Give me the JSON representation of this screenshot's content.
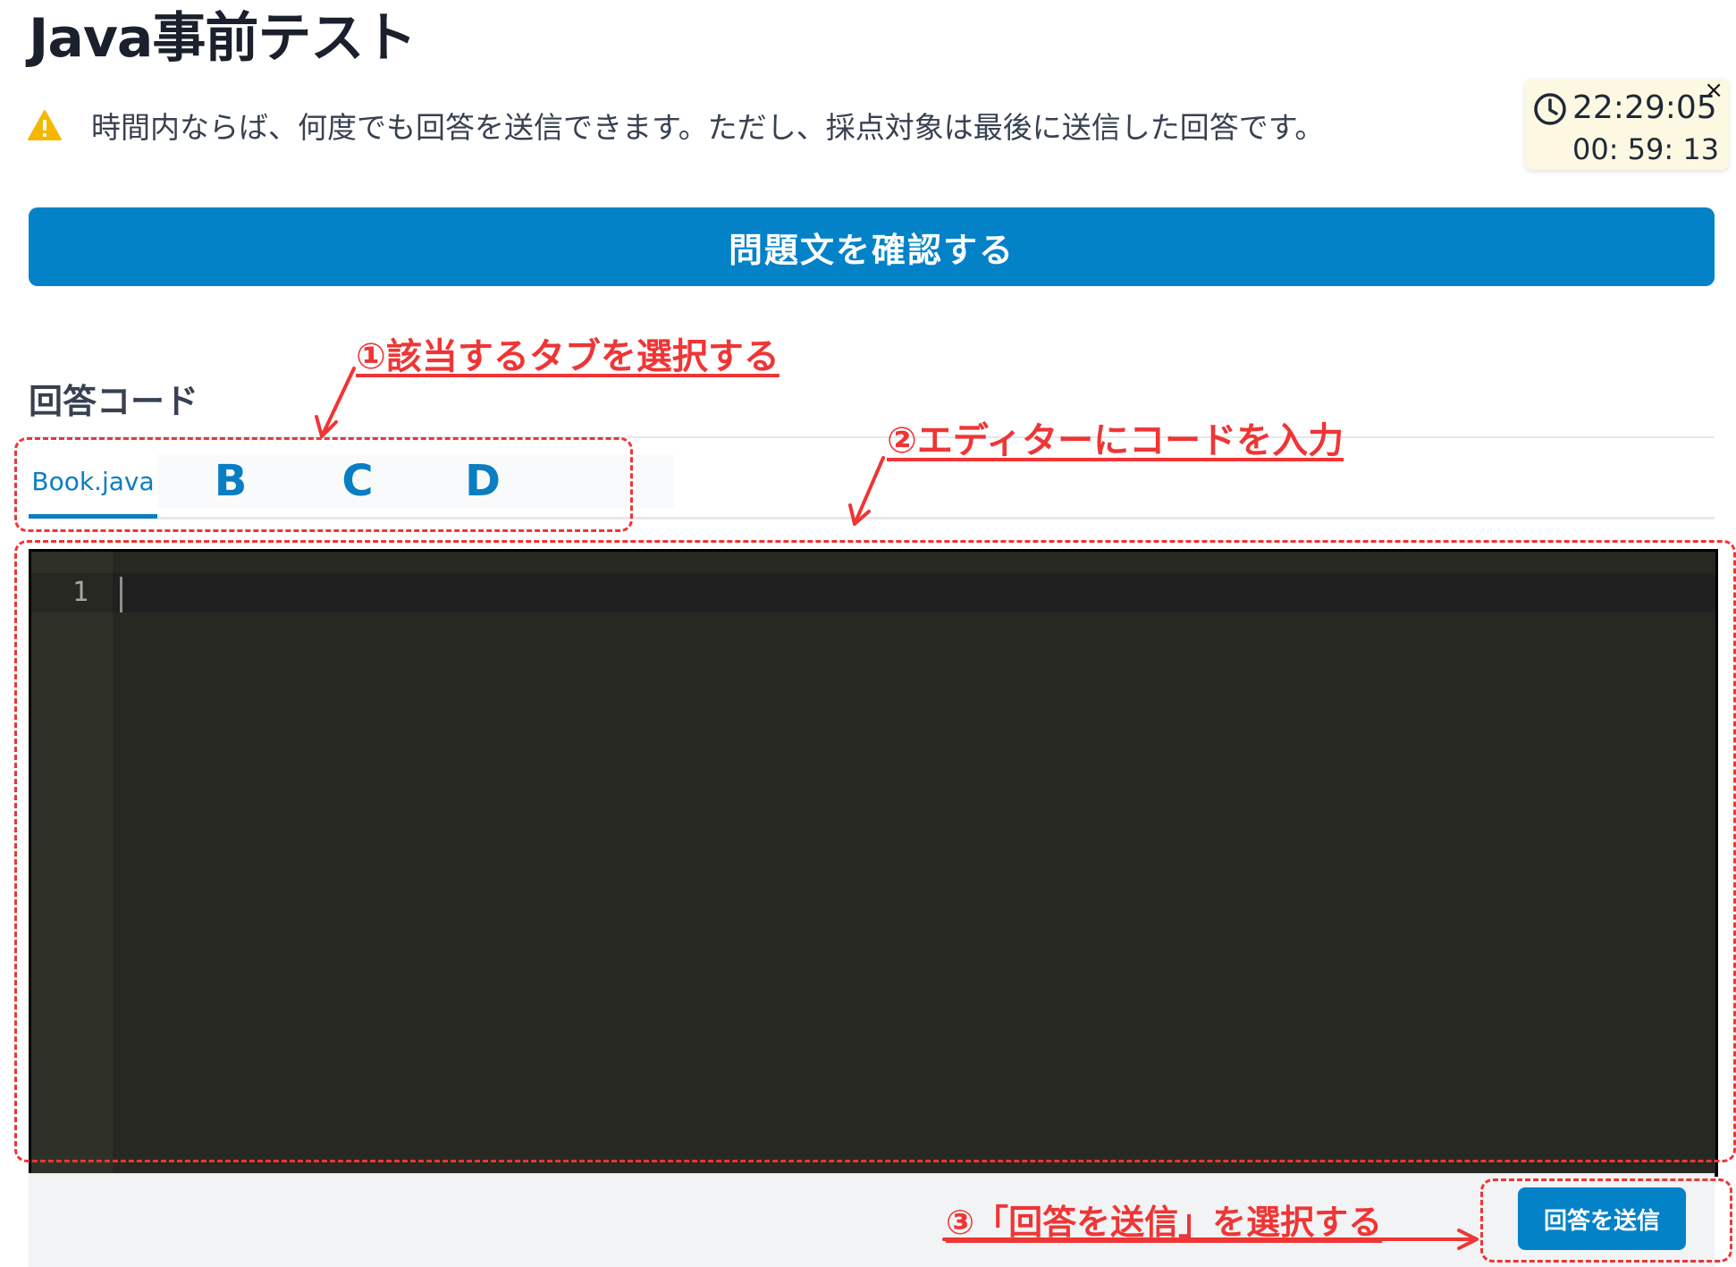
{
  "page": {
    "title": "Java事前テスト",
    "notice": "時間内ならば、何度でも回答を送信できます。ただし、採点対象は最後に送信した回答です。"
  },
  "timer": {
    "close": "×",
    "current_time": "22:29:05",
    "remaining": "00: 59: 13"
  },
  "actions": {
    "view_problem": "問題文を確認する",
    "submit": "回答を送信"
  },
  "answer": {
    "section_title": "回答コード",
    "tabs": [
      {
        "label": "Book.java",
        "active": true
      },
      {
        "label": "B",
        "active": false
      },
      {
        "label": "C",
        "active": false
      },
      {
        "label": "D",
        "active": false
      }
    ]
  },
  "editor": {
    "line_numbers": [
      "1"
    ],
    "code": ""
  },
  "annotations": [
    "①該当するタブを選択する",
    "②エディターにコードを入力",
    "③「回答を送信」を選択する"
  ],
  "colors": {
    "primary": "#0382c8",
    "annotation": "#ef3535",
    "editor_bg": "#272822",
    "warning": "#f5b700"
  }
}
